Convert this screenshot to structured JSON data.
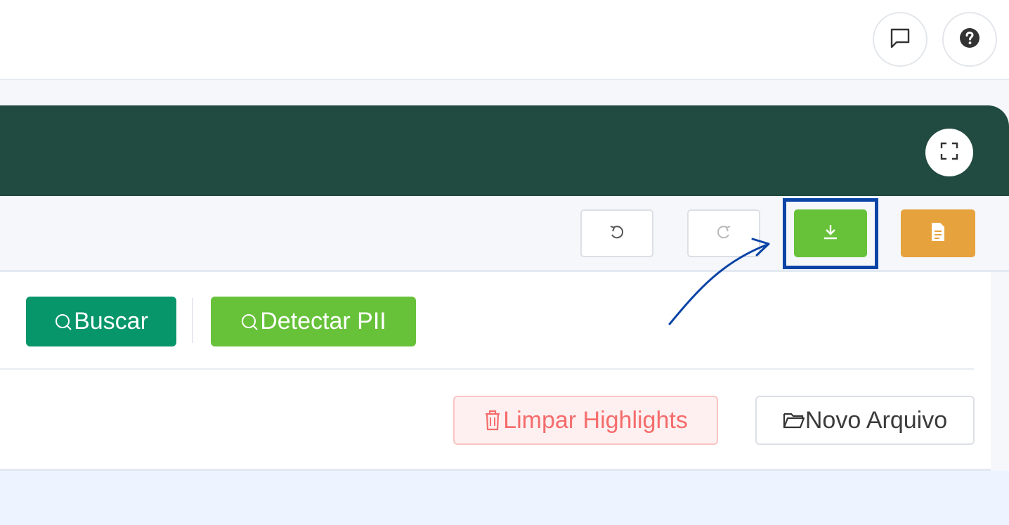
{
  "topbar": {
    "chat_icon": "chat-bubble-icon",
    "help_icon": "question-circle-icon"
  },
  "header": {
    "fullscreen_icon": "fullscreen-icon",
    "colors": {
      "header_bg": "#214a40"
    }
  },
  "toolbar": {
    "undo_icon": "undo-icon",
    "redo_icon": "redo-icon",
    "download_icon": "download-icon",
    "document_icon": "document-icon",
    "colors": {
      "download": "#67c23a",
      "document": "#e6a23c",
      "highlight_border": "#0b44a6"
    }
  },
  "search": {
    "buscar_label": "Buscar",
    "detectar_label": "Detectar PII",
    "colors": {
      "buscar": "#079669",
      "detectar": "#67c23a"
    }
  },
  "actions": {
    "limpar_label": "Limpar Highlights",
    "novo_label": "Novo Arquivo",
    "colors": {
      "limpar_text": "#f56c6c",
      "limpar_bg": "#fef0f0"
    }
  }
}
